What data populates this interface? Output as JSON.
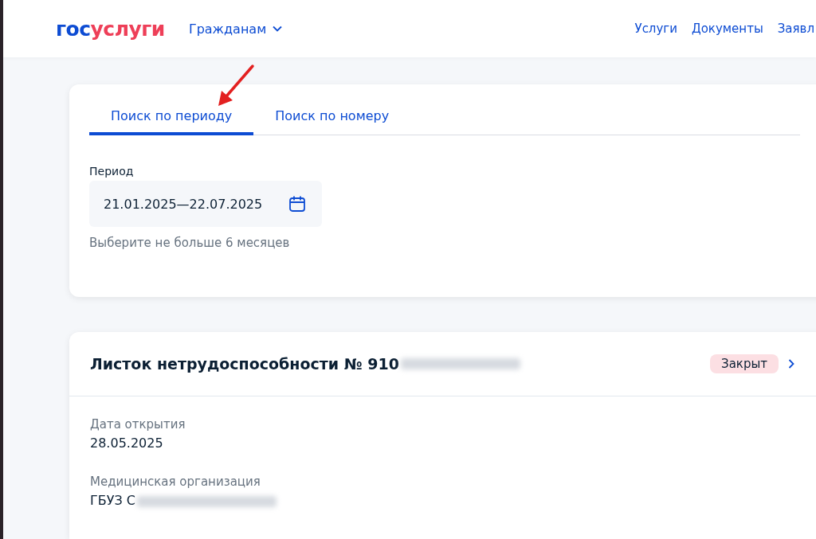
{
  "header": {
    "logo": [
      {
        "text": "гос",
        "color": "#0d4cd3"
      },
      {
        "text": "услуги",
        "color": "#ee3f58"
      }
    ],
    "audience": "Гражданам",
    "nav": [
      "Услуги",
      "Документы",
      "Заявл"
    ]
  },
  "search": {
    "tabs": [
      {
        "label": "Поиск по периоду",
        "selected": true
      },
      {
        "label": "Поиск по номеру",
        "selected": false
      }
    ],
    "period": {
      "label": "Период",
      "value": "21.01.2025—22.07.2025",
      "hint": "Выберите не больше 6 месяцев"
    }
  },
  "annotation": {
    "kind": "arrow"
  },
  "record": {
    "title": "Листок нетрудоспособности № 910",
    "status": "Закрыт",
    "fields": [
      {
        "label": "Дата открытия",
        "value": "28.05.2025",
        "redacted": false
      },
      {
        "label": "Медицинская организация",
        "value": "ГБУЗ С",
        "redacted": true
      }
    ]
  }
}
